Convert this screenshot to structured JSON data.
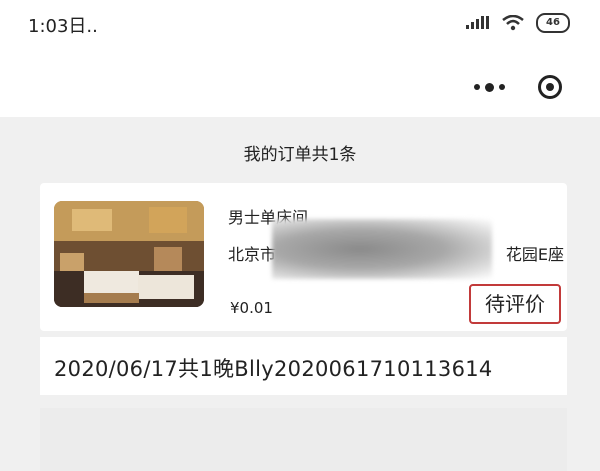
{
  "status_bar": {
    "time": "1:03日..",
    "battery": "46"
  },
  "nav": {
    "more_icon": "more-dots-icon",
    "close_icon": "target-circle-icon"
  },
  "summary": {
    "text": "我的订单共1条"
  },
  "order": {
    "room_type": "男士单床间",
    "address_start": "北京市",
    "address_end": "花园E座",
    "price": "¥0.01",
    "status": "待评价",
    "info": "2020/06/17共1晚Blly2020061710113614"
  },
  "colors": {
    "status_border": "#c23a3a",
    "page_bg": "#f0f0f0"
  }
}
